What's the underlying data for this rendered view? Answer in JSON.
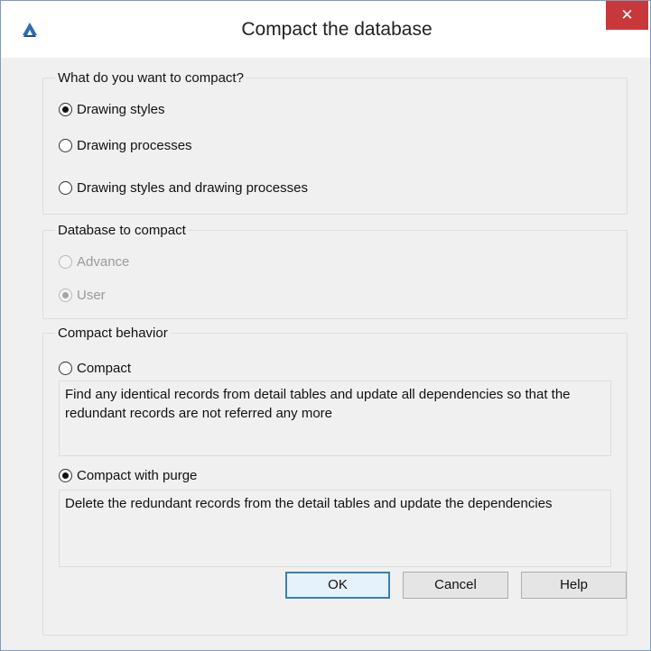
{
  "window": {
    "title": "Compact the database",
    "close_label": "✕",
    "icon": "autocad-a-icon"
  },
  "group_compact_what": {
    "legend": "What do you want to compact?",
    "options": [
      {
        "label": "Drawing styles",
        "selected": true
      },
      {
        "label": "Drawing processes",
        "selected": false
      },
      {
        "label": "Drawing styles and drawing processes",
        "selected": false
      }
    ]
  },
  "group_database": {
    "legend": "Database to compact",
    "options": [
      {
        "label": "Advance",
        "selected": false,
        "disabled": true
      },
      {
        "label": "User",
        "selected": true,
        "disabled": true
      }
    ]
  },
  "group_behavior": {
    "legend": "Compact behavior",
    "compact": {
      "label": "Compact",
      "selected": false,
      "description": "Find any identical records from detail tables and update all dependencies so that the redundant records are not referred any more"
    },
    "compact_purge": {
      "label": "Compact with purge",
      "selected": true,
      "description": "Delete the redundant records from the detail tables and update the dependencies"
    }
  },
  "buttons": {
    "ok": "OK",
    "cancel": "Cancel",
    "help": "Help"
  }
}
